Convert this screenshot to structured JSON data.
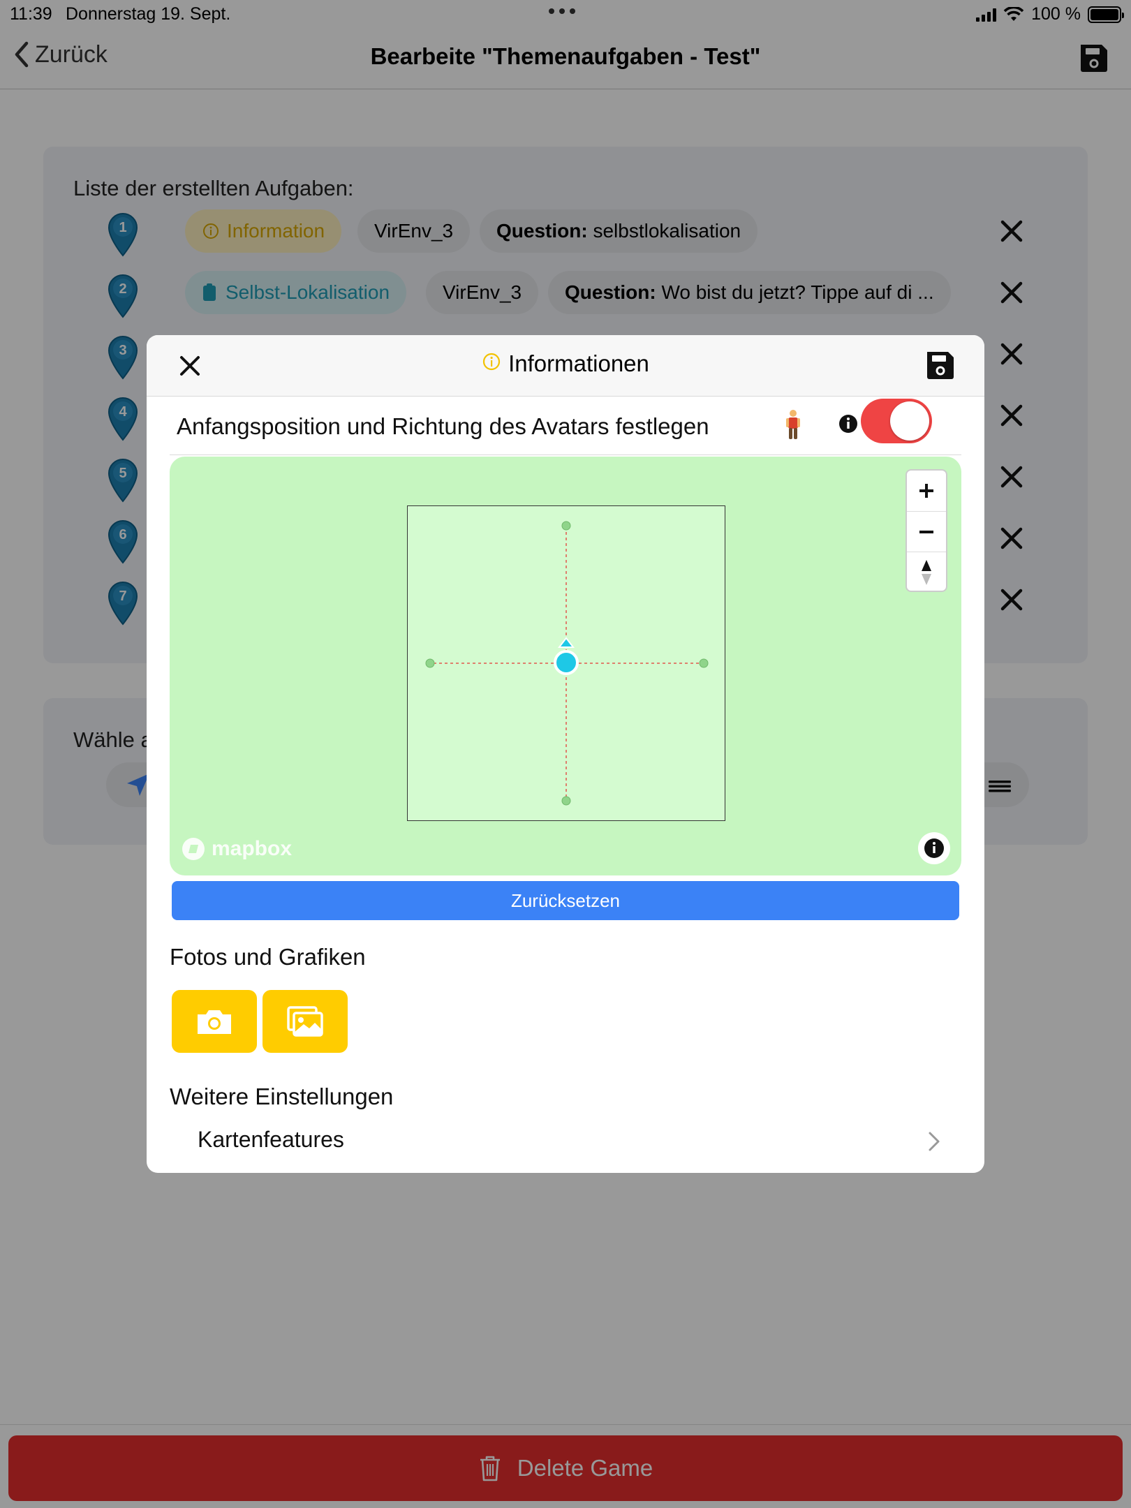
{
  "status_bar": {
    "time": "11:39",
    "date": "Donnerstag 19. Sept.",
    "battery": "100 %"
  },
  "nav": {
    "back_label": "Zurück",
    "title": "Bearbeite \"Themenaufgaben - Test\""
  },
  "task_list": {
    "label": "Liste der erstellten Aufgaben:",
    "items": [
      {
        "number": "1",
        "chips": [
          {
            "type": "info",
            "text": "Information"
          },
          {
            "type": "plain",
            "text": "VirEnv_3"
          },
          {
            "type": "question",
            "bold": "Question:",
            "text": " selbstlokalisation"
          }
        ]
      },
      {
        "number": "2",
        "chips": [
          {
            "type": "selbst",
            "text": "Selbst-Lokalisation"
          },
          {
            "type": "plain",
            "text": "VirEnv_3"
          },
          {
            "type": "question",
            "bold": "Question:",
            "text": " Wo bist du jetzt? Tippe auf di ..."
          }
        ]
      },
      {
        "number": "3"
      },
      {
        "number": "4"
      },
      {
        "number": "5"
      },
      {
        "number": "6"
      },
      {
        "number": "7"
      }
    ]
  },
  "choose_section": {
    "label": "Wähle a"
  },
  "delete_button": {
    "label": "Delete Game"
  },
  "modal": {
    "title": "Informationen",
    "avatar_setting_label": "Anfangsposition und Richtung des Avatars festlegen",
    "avatar_toggle_on": true,
    "map_attribution": "mapbox",
    "reset_label": "Zurücksetzen",
    "photos_title": "Fotos und Grafiken",
    "more_settings_title": "Weitere Einstellungen",
    "map_features_label": "Kartenfeatures"
  },
  "colors": {
    "accent_blue": "#3b82f6",
    "toggle_red": "#ef4444",
    "photo_yellow": "#ffcc00",
    "delete_red": "#e42d2d",
    "map_green": "#c6f6c0",
    "pin_blue": "#1d7fb0",
    "avatar_cyan": "#1ec8e6"
  }
}
